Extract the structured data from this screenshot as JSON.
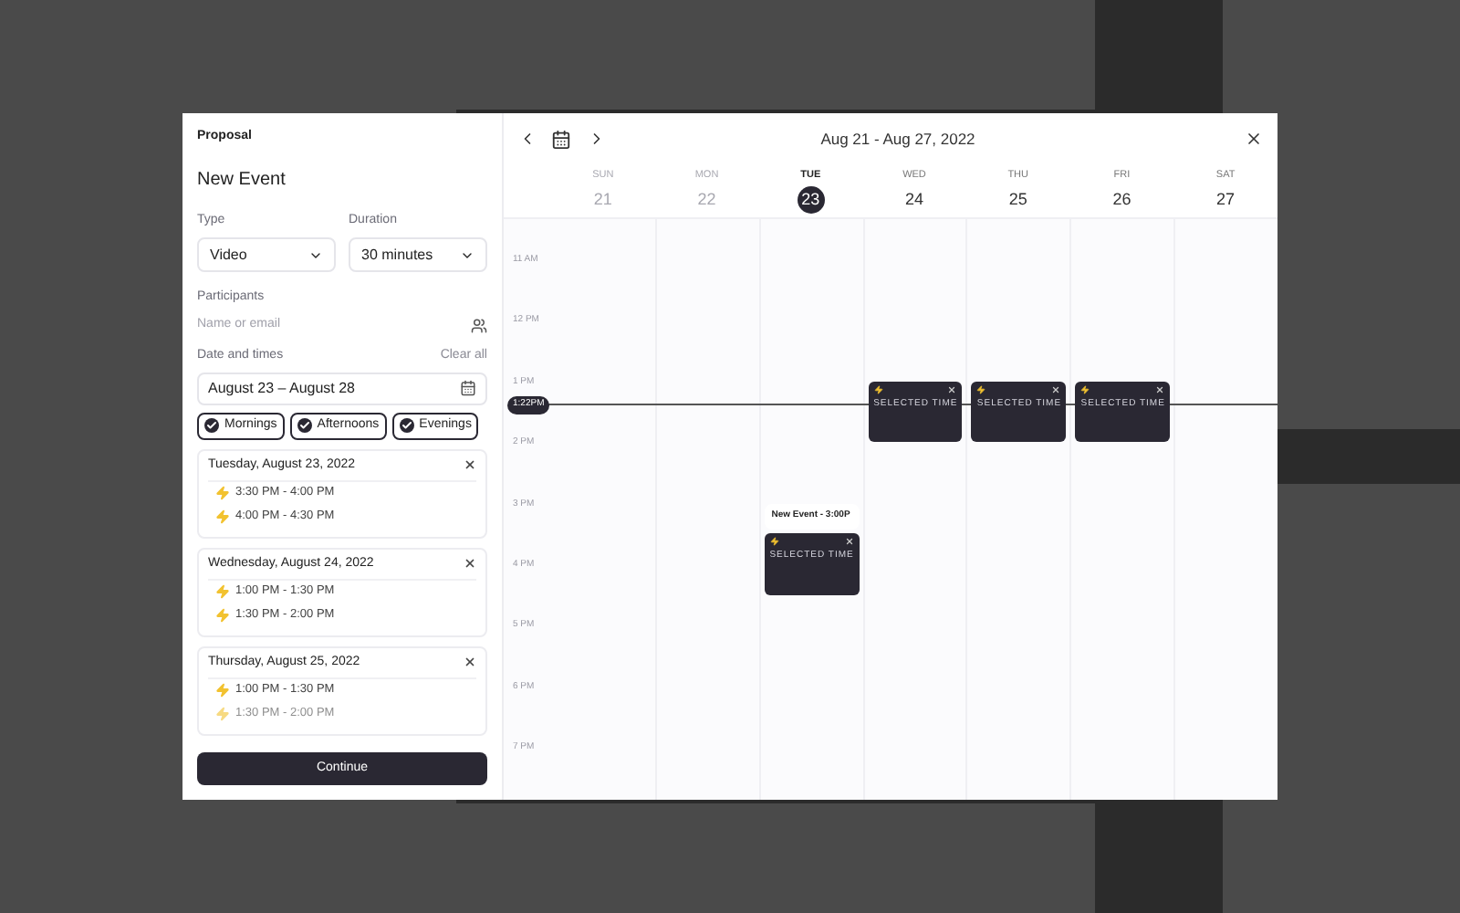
{
  "panel": {
    "breadcrumb": "Proposal",
    "title": "New Event",
    "type": {
      "label": "Type",
      "value": "Video"
    },
    "duration": {
      "label": "Duration",
      "value": "30 minutes"
    },
    "participants": {
      "label": "Participants",
      "placeholder": "Name or email"
    },
    "dates": {
      "label": "Date and times",
      "clear": "Clear all",
      "range": "August 23 – August 28"
    },
    "chips": [
      {
        "label": "Mornings",
        "checked": true
      },
      {
        "label": "Afternoons",
        "checked": true
      },
      {
        "label": "Evenings",
        "checked": true
      }
    ],
    "days": [
      {
        "title": "Tuesday, August 23, 2022",
        "slots": [
          {
            "text": "3:30 PM - 4:00 PM",
            "faded": false
          },
          {
            "text": "4:00 PM - 4:30 PM",
            "faded": false
          }
        ]
      },
      {
        "title": "Wednesday, August 24, 2022",
        "slots": [
          {
            "text": "1:00 PM - 1:30 PM",
            "faded": false
          },
          {
            "text": "1:30 PM - 2:00 PM",
            "faded": false
          }
        ]
      },
      {
        "title": "Thursday, August 25, 2022",
        "slots": [
          {
            "text": "1:00 PM - 1:30 PM",
            "faded": false
          },
          {
            "text": "1:30 PM - 2:00 PM",
            "faded": true
          }
        ]
      }
    ],
    "continue": "Continue"
  },
  "calendar": {
    "range": "Aug 21 - Aug 27, 2022",
    "now": "1:22PM",
    "hours": [
      "11 AM",
      "12 PM",
      "1 PM",
      "2 PM",
      "3 PM",
      "4 PM",
      "5 PM",
      "6 PM",
      "7 PM"
    ],
    "days": [
      {
        "name": "SUN",
        "date": "21",
        "past": true,
        "selected": false
      },
      {
        "name": "MON",
        "date": "22",
        "past": true,
        "selected": false
      },
      {
        "name": "TUE",
        "date": "23",
        "past": false,
        "selected": true,
        "events": [
          {
            "label": "SELECTED TIME",
            "tooltip": "New Event - 3:00P"
          }
        ]
      },
      {
        "name": "WED",
        "date": "24",
        "past": false,
        "selected": false,
        "events": [
          {
            "label": "SELECTED TIME"
          }
        ]
      },
      {
        "name": "THU",
        "date": "25",
        "past": false,
        "selected": false,
        "events": [
          {
            "label": "SELECTED TIME"
          }
        ]
      },
      {
        "name": "FRI",
        "date": "26",
        "past": false,
        "selected": false,
        "events": [
          {
            "label": "SELECTED TIME"
          }
        ]
      },
      {
        "name": "SAT",
        "date": "27",
        "past": false,
        "selected": false
      }
    ]
  }
}
